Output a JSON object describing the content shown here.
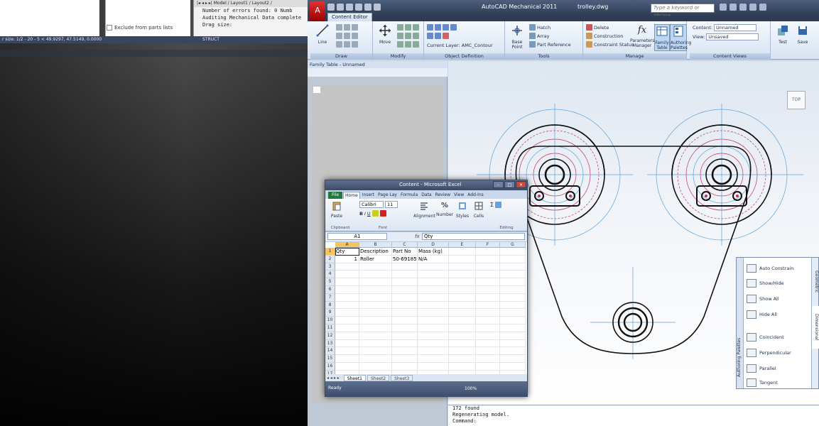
{
  "left_bg": {
    "exclude_label": "Exclude from parts lists",
    "cmd_tabs": "|◂ ◂ ▸ ▸| Model / Layout1 / Layout2 /",
    "cmd_lines": [
      "Number of errors found: 0    Numb",
      "Auditing Mechanical Data complete",
      "Drag size:"
    ],
    "status_text": "r size: 1/2 - 20 - 5 <  49.9297, 47.5149, 0.0000",
    "struct_label": "STRUCT"
  },
  "autocad": {
    "title": "AutoCAD Mechanical 2011",
    "file": "trolley.dwg",
    "search_placeholder": "Type a keyword or phrase",
    "app_button_glyph": "A",
    "contextual_tab": "Content Editor",
    "panels": {
      "draw": "Draw",
      "modify": "Modify",
      "object_definition": "Object Definition",
      "tools": "Tools",
      "manage": "Manage",
      "content_views": "Content Views"
    },
    "ribbon_items": {
      "line": "Line",
      "move": "Move",
      "current_layer": "Current Layer: AMC_Contour",
      "base_point": "Base Point",
      "hatch": "Hatch",
      "array": "Array",
      "part_reference": "Part Reference",
      "delete": "Delete",
      "construction": "Construction",
      "constraint_status": "Constraint Status",
      "parameters_manager": "Parameters Manager",
      "family_table": "Family Table",
      "authoring_palettes": "Authoring Palettes",
      "content_label": "Content:",
      "content_value": "Unnamed",
      "view_label": "View:",
      "view_value": "Unsaved",
      "test": "Test",
      "save": "Save"
    },
    "family_table_title": "Family Table - Unnamed",
    "viewcube_label": "TOP",
    "cmdline": [
      "172 found",
      "Regenerating model.",
      "Command:"
    ],
    "palette": {
      "strip_label": "Authoring Palettes",
      "tab_geometric": "Geometric",
      "tab_dimensional": "Dimensional",
      "items": [
        "Auto Constrain",
        "Show/Hide",
        "Show All",
        "Hide All",
        "Coincident",
        "Perpendicular",
        "Parallel",
        "Tangent"
      ]
    },
    "colors": {
      "contour": "#111111",
      "center_line": "#5aa0d8",
      "hidden": "#c0306a"
    }
  },
  "excel": {
    "title": "Content - Microsoft Excel",
    "tabs": [
      "File",
      "Home",
      "Insert",
      "Page Lay",
      "Formula",
      "Data",
      "Review",
      "View",
      "Add-Ins"
    ],
    "ribbon": {
      "paste": "Paste",
      "font_name": "Calibri",
      "font_size": "11",
      "alignment": "Alignment",
      "number": "Number",
      "styles": "Styles",
      "cells": "Cells",
      "groups": [
        "Clipboard",
        "Font",
        "Editing"
      ]
    },
    "name_box": "A1",
    "fx": "fx",
    "formula_value": "Qty",
    "columns": [
      "A",
      "B",
      "C",
      "D",
      "E",
      "F",
      "G"
    ],
    "rows": [
      {
        "n": "1",
        "cells": [
          "Qty",
          "Description",
          "Part No",
          "Mass (kg)",
          "",
          "",
          ""
        ]
      },
      {
        "n": "2",
        "cells": [
          "1",
          "Roller",
          "50-69185",
          "N/A",
          "",
          "",
          ""
        ]
      },
      {
        "n": "3",
        "cells": [
          "",
          "",
          "",
          "",
          "",
          "",
          ""
        ]
      },
      {
        "n": "4",
        "cells": [
          "",
          "",
          "",
          "",
          "",
          "",
          ""
        ]
      },
      {
        "n": "5",
        "cells": [
          "",
          "",
          "",
          "",
          "",
          "",
          ""
        ]
      },
      {
        "n": "6",
        "cells": [
          "",
          "",
          "",
          "",
          "",
          "",
          ""
        ]
      },
      {
        "n": "7",
        "cells": [
          "",
          "",
          "",
          "",
          "",
          "",
          ""
        ]
      },
      {
        "n": "8",
        "cells": [
          "",
          "",
          "",
          "",
          "",
          "",
          ""
        ]
      },
      {
        "n": "9",
        "cells": [
          "",
          "",
          "",
          "",
          "",
          "",
          ""
        ]
      },
      {
        "n": "10",
        "cells": [
          "",
          "",
          "",
          "",
          "",
          "",
          ""
        ]
      },
      {
        "n": "11",
        "cells": [
          "",
          "",
          "",
          "",
          "",
          "",
          ""
        ]
      },
      {
        "n": "12",
        "cells": [
          "",
          "",
          "",
          "",
          "",
          "",
          ""
        ]
      },
      {
        "n": "13",
        "cells": [
          "",
          "",
          "",
          "",
          "",
          "",
          ""
        ]
      },
      {
        "n": "14",
        "cells": [
          "",
          "",
          "",
          "",
          "",
          "",
          ""
        ]
      },
      {
        "n": "15",
        "cells": [
          "",
          "",
          "",
          "",
          "",
          "",
          ""
        ]
      },
      {
        "n": "16",
        "cells": [
          "",
          "",
          "",
          "",
          "",
          "",
          ""
        ]
      },
      {
        "n": "17",
        "cells": [
          "",
          "",
          "",
          "",
          "",
          "",
          ""
        ]
      }
    ],
    "sheets": [
      "Sheet1",
      "Sheet2",
      "Sheet3"
    ],
    "status": "Ready",
    "zoom": "100%"
  }
}
